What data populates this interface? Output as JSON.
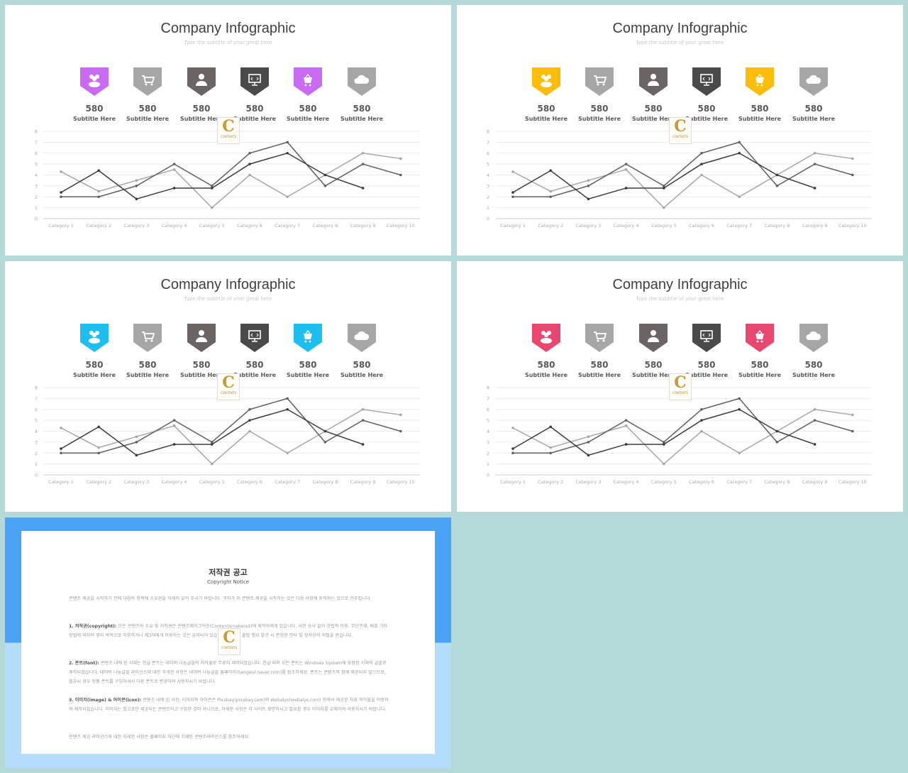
{
  "slides": [
    {
      "title": "Company Infographic",
      "subtitle": "Type the subtitle of your great here",
      "accent": "#c86bf2"
    },
    {
      "title": "Company Infographic",
      "subtitle": "Type the subtitle of your great here",
      "accent": "#fbbd08"
    },
    {
      "title": "Company Infographic",
      "subtitle": "Type the subtitle of your great here",
      "accent": "#1ebfef"
    },
    {
      "title": "Company Infographic",
      "subtitle": "Type the subtitle of your great here",
      "accent": "#e8476f"
    }
  ],
  "icons": [
    {
      "name": "users-icon",
      "color": "accent",
      "value": "580",
      "label": "Subtitle Here"
    },
    {
      "name": "shopping-cart-icon",
      "color": "#a6a6a6",
      "value": "580",
      "label": "Subtitle Here"
    },
    {
      "name": "person-icon",
      "color": "#6b6464",
      "value": "580",
      "label": "Subtitle Here"
    },
    {
      "name": "monitor-code-icon",
      "color": "#4a4a4a",
      "value": "580",
      "label": "Subtitle Here"
    },
    {
      "name": "basket-icon",
      "color": "accent",
      "value": "580",
      "label": "Subtitle Here"
    },
    {
      "name": "cloud-icon",
      "color": "#a6a6a6",
      "value": "580",
      "label": "Subtitle Here"
    }
  ],
  "watermark": {
    "letter": "C",
    "text": "CONTENTS"
  },
  "chart_data": {
    "type": "line",
    "categories": [
      "Category 1",
      "Category 2",
      "Category 3",
      "Category 4",
      "Category 5",
      "Category 6",
      "Category 7",
      "Category 8",
      "Category 9",
      "Category 10"
    ],
    "ylim": [
      0,
      8
    ],
    "yticks": [
      "0",
      "1",
      "2",
      "3",
      "4",
      "5",
      "6",
      "7",
      "8"
    ],
    "grid": true,
    "series": [
      {
        "values": [
          4.3,
          2.5,
          3.5,
          4.5,
          1,
          4,
          2,
          4,
          6,
          5.5
        ],
        "color": "#a6a6a6"
      },
      {
        "values": [
          2,
          2,
          3,
          5,
          3,
          6,
          7,
          3,
          5,
          4
        ],
        "color": "#5f5f5f"
      },
      {
        "values": [
          2.4,
          4.4,
          1.8,
          2.8,
          2.8,
          5,
          6,
          4,
          2.8,
          null
        ],
        "color": "#3a3a3a"
      }
    ]
  },
  "notice": {
    "title": "저작권 공고",
    "subtitle": "Copyright Notice",
    "intro": "콘텐츠 제공을 시작하기 전에 다음의 항목에 소유권을 자세히 읽어 주시기 바랍니다. 귀하가 이 콘텐츠 제공을 시작하는 것은 다음 사항에 동의하는 것으로 간주됩니다.",
    "items": [
      {
        "head": "1. 저작권(copyright):",
        "body": "모든 콘텐츠의 소유 및 저작권은 콘텐츠메이크어웃(Contentsmakeout)에 제작자에게 있습니다. 사전 승낙 없이 공법적 이용, 무단전재, 배포 기타 방법에 의하여 영리 목적으로 이용하거나 제3자에게 이용하는 것은 금지되어 있습니다. 이러한 불법 행위 발견 시 준엄한 민사 및 형사상의 처벌을 받습니다."
      },
      {
        "head": "2. 폰트(font):",
        "body": "콘텐츠 내에 된 서체는 한글 폰트는 네이버 나눔글꼴의 저작물로 무료이 제작되었습니다. 한글 외의 모든 폰트는 Windows System에 포함된 서체의 글꼴로 제작되었습니다. 네이버 나눔글꼴 라이선스에 대한 자세한 사항은 네이버 나눔글꼴 홈페이지(hangeul.naver.com)를 참조하세요. 폰트는 콘텐츠의 함께 제공되지 않으므로, 필요시 경우 정품 폰트를 구입하셔서 다른 폰트로 변경하여 사용하시기 바랍니다."
      },
      {
        "head": "3. 이미지(image) & 아이콘(icon):",
        "body": "콘텐츠 내에 된 사진, 이미지와 아이콘은 Pixabay(pixabay.com)와 Webalys(webalys.com) 등에서 제공된 자료 저작물을 이용하여 제작되었습니다. 이미지는 참고로만 제공되는 콘텐츠이고 구입한 것이 아니므로, 자세한 사항은 각 사이트 확인하시고 필요할 경우 이미지를 교체하여 사용하시기 바랍니다."
      }
    ],
    "outro": "콘텐츠 제공 라이선스에 대한 자세한 사항은 홈페이지 하단에 기재된 콘텐츠라이선스를 참조하세요."
  }
}
